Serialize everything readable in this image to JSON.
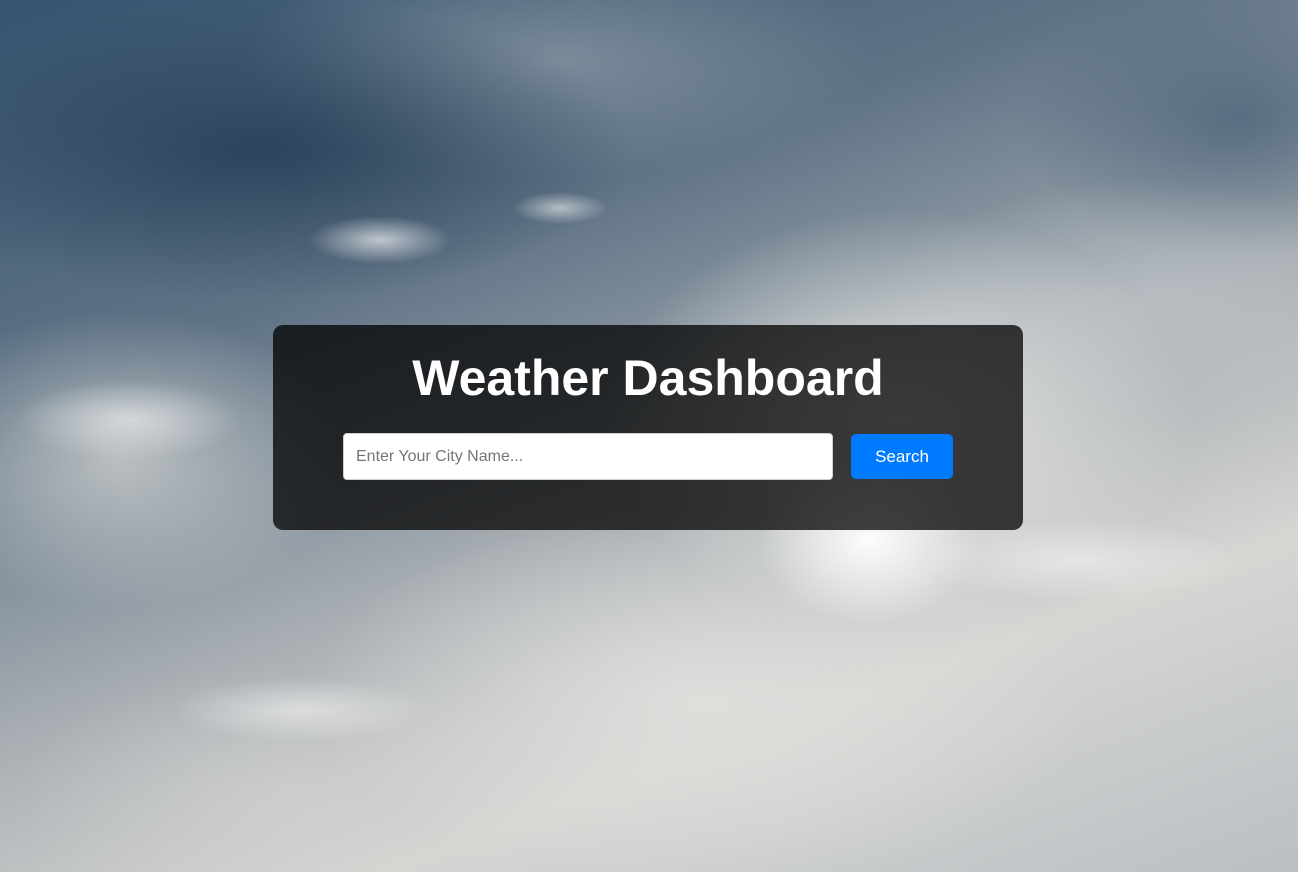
{
  "colors": {
    "card_background": "rgba(0,0,0,0.75)",
    "title_text": "#ffffff",
    "button_background": "#007bff",
    "button_text": "#ffffff",
    "input_background": "#ffffff"
  },
  "dashboard": {
    "title": "Weather Dashboard",
    "search": {
      "placeholder": "Enter Your City Name...",
      "value": "",
      "button_label": "Search"
    }
  }
}
